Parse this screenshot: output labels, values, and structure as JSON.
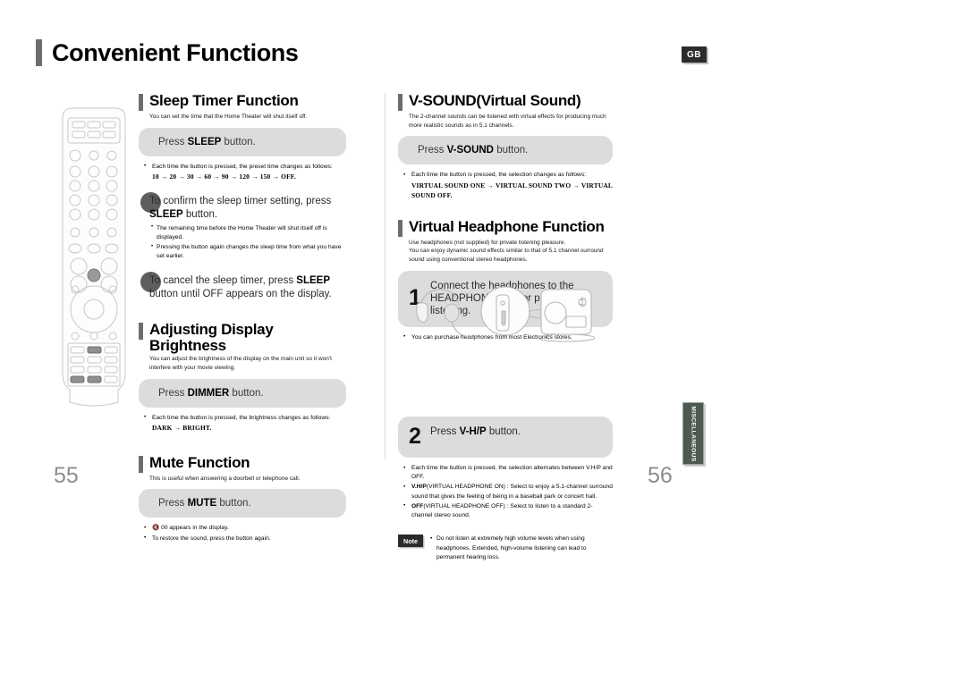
{
  "header": {
    "title": "Convenient Functions",
    "region_badge": "GB"
  },
  "side_tab": {
    "label": "MISCELLANEOUS"
  },
  "pages": {
    "left": "55",
    "right": "56"
  },
  "left_column": {
    "sleep_timer": {
      "heading": "Sleep Timer Function",
      "description": "You can set the time that the Home Theater will shut itself off.",
      "action_prefix": "Press ",
      "action_key": "SLEEP",
      "action_suffix": " button.",
      "bullets": [
        {
          "text": "Each time the button is pressed, the preset time changes as follows:",
          "sequence": "10 → 20 → 30 → 60 → 90 → 120 → 150 → OFF."
        }
      ],
      "callouts": [
        {
          "line_before": "To confirm the sleep timer setting, press ",
          "key": "SLEEP",
          "line_after": " button.",
          "bullets": [
            "The remaining time before the Home Theater will shut itself off is displayed.",
            "Pressing the button again changes the sleep time from what you have set earlier."
          ]
        },
        {
          "line_before": "To cancel the sleep timer, press ",
          "key": "SLEEP",
          "line_after": " button until OFF appears on the display.",
          "bullets": []
        }
      ]
    },
    "display_brightness": {
      "heading": "Adjusting Display Brightness",
      "description": "You can adjust the brightness of the display on the main unit so it won't interfere with your movie viewing.",
      "action_prefix": "Press ",
      "action_key": "DIMMER",
      "action_suffix": " button.",
      "bullets": [
        {
          "text": "Each time the button is pressed, the brightness changes as follows:",
          "sequence": "DARK → BRIGHT."
        }
      ]
    },
    "mute": {
      "heading": "Mute Function",
      "description": "This is useful when answering a doorbell or telephone call.",
      "action_prefix": "Press ",
      "action_key": "MUTE",
      "action_suffix": " button.",
      "bullets": [
        "🔇 00 appears in the display.",
        "To restore the sound, press the button again."
      ]
    }
  },
  "right_column": {
    "v_sound": {
      "heading": "V-SOUND(Virtual Sound)",
      "description": "The 2-channel sounds can be listened with virtual effects for producing much more realistic sounds as in 5.1 channels.",
      "action_prefix": "Press ",
      "action_key": "V-SOUND",
      "action_suffix": " button.",
      "bullets": [
        {
          "text": "Each time the button is pressed, the selection changes as follows:",
          "sequence": "VIRTUAL SOUND ONE →  VIRTUAL SOUND TWO →  VIRTUAL SOUND OFF."
        }
      ]
    },
    "virtual_headphone": {
      "heading": "Virtual Headphone Function",
      "description": "Use headphones (not supplied) for private listening pleasure.\nYou can enjoy dynamic sound effects similar to that of 5.1 channel surround sound using conventional stereo headphones.",
      "step1": {
        "number": "1",
        "text": "Connect the headphones to the HEADPHONE jack for private listening.",
        "bullets": [
          "You can purchase headphones from most Electronics stores."
        ]
      },
      "step2": {
        "number": "2",
        "action_prefix": "Press ",
        "action_key": "V-H/P",
        "action_suffix": " button.",
        "bullets": [
          {
            "bold": "",
            "text": "Each time the button is pressed, the selection alternates between V.H/P and OFF."
          },
          {
            "bold": "V.H/P",
            "text": "(VIRTUAL HEADPHONE ON) : Select to enjoy a 5.1-channel surround sound that gives the feeling of being in a baseball park or concert hall."
          },
          {
            "bold": "OFF",
            "text": "(VIRTUAL HEADPHONE OFF) : Select to listen to a standard 2-channel stereo sound."
          }
        ]
      },
      "note": {
        "tag": "Note",
        "text": "Do not listen at extremely high volume levels when using headphones. Extended, high-volume listening can lead to permanent hearing loss."
      }
    }
  },
  "illustrations": {
    "remote": "remote-control-illustration",
    "headphone_unit": "headphone-and-main-unit-illustration"
  }
}
